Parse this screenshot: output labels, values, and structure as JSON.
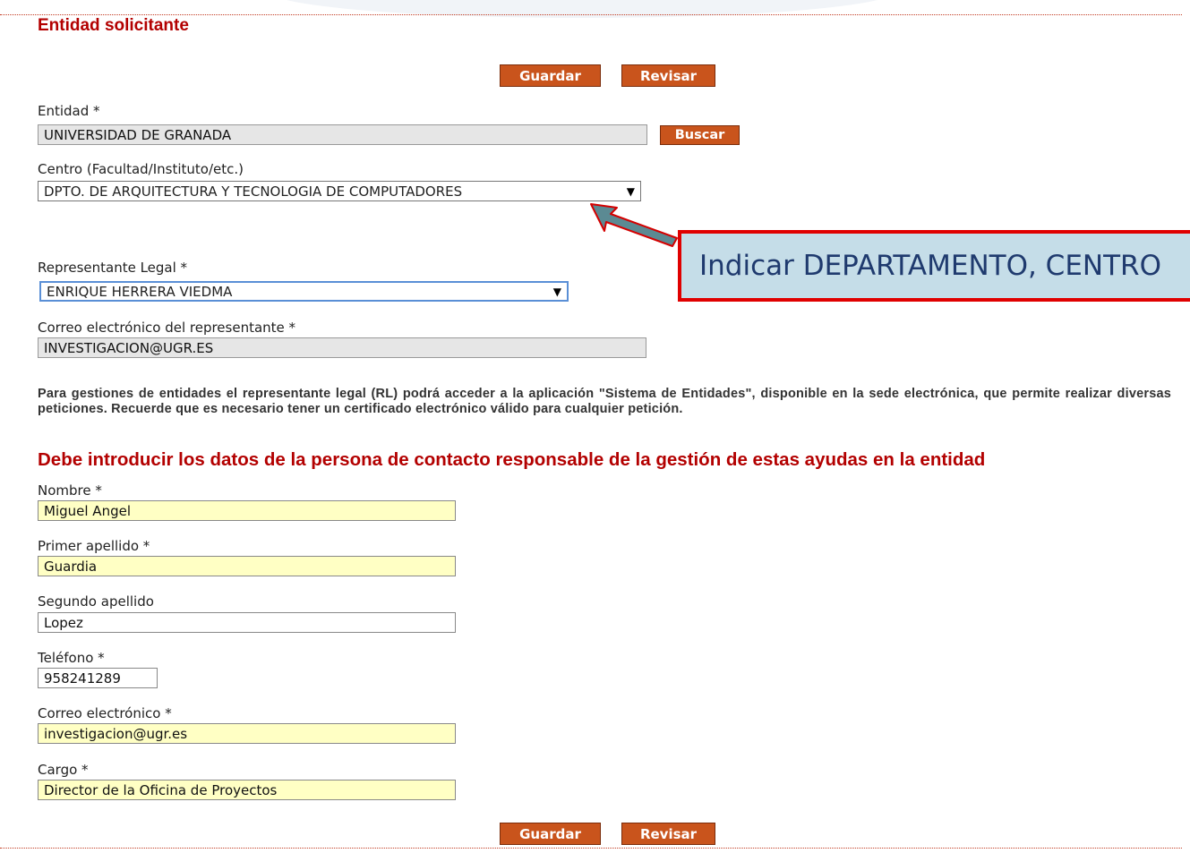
{
  "section_title": "Entidad solicitante",
  "buttons": {
    "guardar": "Guardar",
    "revisar": "Revisar",
    "buscar": "Buscar"
  },
  "fields": {
    "entidad": {
      "label": "Entidad *",
      "value": "UNIVERSIDAD DE GRANADA"
    },
    "centro": {
      "label": "Centro (Facultad/Instituto/etc.)",
      "value": "DPTO. DE ARQUITECTURA Y TECNOLOGIA DE COMPUTADORES"
    },
    "representante": {
      "label": "Representante Legal *",
      "value": "ENRIQUE HERRERA VIEDMA"
    },
    "correo_representante": {
      "label": "Correo electrónico del representante *",
      "value": "INVESTIGACION@UGR.ES"
    }
  },
  "info_text": "Para gestiones de entidades el representante legal (RL) podrá acceder a la aplicación \"Sistema de Entidades\", disponible en la sede electrónica, que permite realizar diversas peticiones. Recuerde que es necesario tener un certificado electrónico válido para cualquier petición.",
  "contact_heading": "Debe introducir los datos de la persona de contacto responsable de la gestión de estas ayudas en la entidad",
  "contact": {
    "nombre": {
      "label": "Nombre *",
      "value": "Miguel Angel"
    },
    "primer_apellido": {
      "label": "Primer apellido *",
      "value": "Guardia"
    },
    "segundo_apellido": {
      "label": "Segundo apellido",
      "value": "Lopez"
    },
    "telefono": {
      "label": "Teléfono *",
      "value": "958241289"
    },
    "correo": {
      "label": "Correo electrónico *",
      "value": "investigacion@ugr.es"
    },
    "cargo": {
      "label": "Cargo *",
      "value": "Director de la Oficina de Proyectos"
    }
  },
  "callout_text": "Indicar DEPARTAMENTO, CENTRO",
  "colors": {
    "accent_red": "#b30000",
    "button": "#c9541c",
    "required_field": "#ffffc4",
    "readonly_field": "#e6e6e6",
    "callout_bg": "#c5dde8",
    "callout_border": "#e00000",
    "arrow": "#5b8a93"
  }
}
